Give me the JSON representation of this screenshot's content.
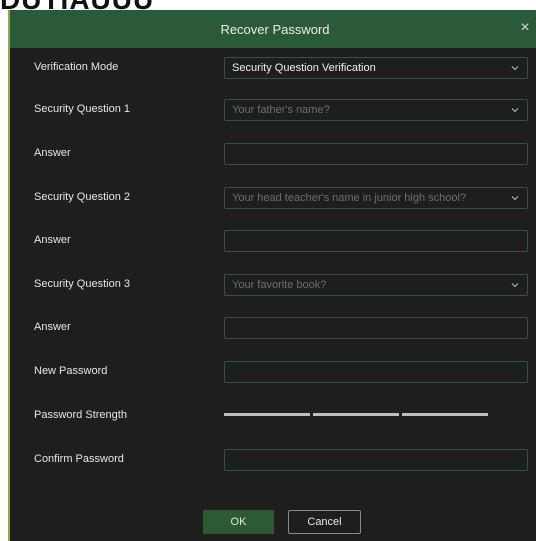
{
  "backdrop": {
    "text": "DUTIAUUU"
  },
  "dialog": {
    "title": "Recover Password",
    "close_glyph": "×",
    "colors": {
      "title_bar": "#2a5a3a",
      "background": "#1e1e1e",
      "field_border": "#33543a",
      "ok_button": "#2c5a32"
    }
  },
  "rows": {
    "mode": {
      "label": "Verification Mode",
      "value": "Security Question Verification"
    },
    "q1": {
      "label": "Security Question 1",
      "value": "Your father's name?"
    },
    "a1": {
      "label": "Answer",
      "value": ""
    },
    "q2": {
      "label": "Security Question 2",
      "value": "Your head teacher's name in junior high school?"
    },
    "a2": {
      "label": "Answer",
      "value": ""
    },
    "q3": {
      "label": "Security Question 3",
      "value": "Your favorite book?"
    },
    "a3": {
      "label": "Answer",
      "value": ""
    },
    "new_pw": {
      "label": "New Password",
      "value": ""
    },
    "strength": {
      "label": "Password Strength",
      "segments": 3,
      "level": 0
    },
    "confirm": {
      "label": "Confirm Password",
      "value": ""
    }
  },
  "buttons": {
    "ok": "OK",
    "cancel": "Cancel"
  },
  "icons": {
    "dropdown": "chevron-down-icon",
    "close": "close-icon"
  }
}
